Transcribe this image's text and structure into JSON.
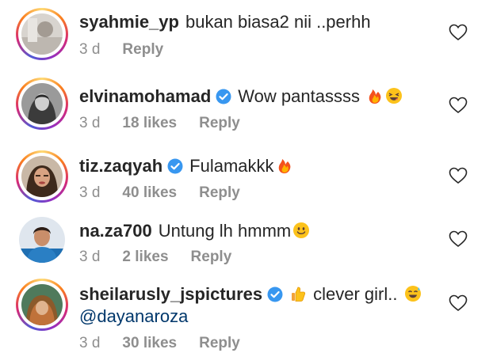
{
  "comments": [
    {
      "username": "syahmie_yp",
      "verified": false,
      "text": "bukan biasa2 nii ..perhh",
      "emojis": [],
      "time": "3 d",
      "likes": "",
      "reply": "Reply",
      "avatar": "avatar-syahmie"
    },
    {
      "username": "elvinamohamad",
      "verified": true,
      "text": "Wow pantassss",
      "emojis": [
        "fire-emoji",
        "squinting-laugh-emoji"
      ],
      "time": "3 d",
      "likes": "18 likes",
      "reply": "Reply",
      "avatar": "avatar-elvina"
    },
    {
      "username": "tiz.zaqyah",
      "verified": true,
      "text": "Fulamakkk",
      "emojis": [
        "fire-emoji"
      ],
      "time": "3 d",
      "likes": "40 likes",
      "reply": "Reply",
      "avatar": "avatar-tiz"
    },
    {
      "username": "na.za700",
      "verified": false,
      "text": "Untung lh hmmm",
      "emojis": [
        "smile-emoji"
      ],
      "time": "3 d",
      "likes": "2 likes",
      "reply": "Reply",
      "avatar": "avatar-naza"
    },
    {
      "username": "sheilarusly_jspictures",
      "verified": true,
      "text": "clever girl..",
      "emojis": [
        "thumbs-up-emoji",
        "sweat-smile-emoji"
      ],
      "mention": "@dayanaroza",
      "time": "3 d",
      "likes": "30 likes",
      "reply": "Reply",
      "avatar": "avatar-sheila"
    }
  ],
  "colors": {
    "text": "#262626",
    "muted": "#8e8e8e",
    "verified": "#3897f0",
    "mention": "#00376b"
  }
}
